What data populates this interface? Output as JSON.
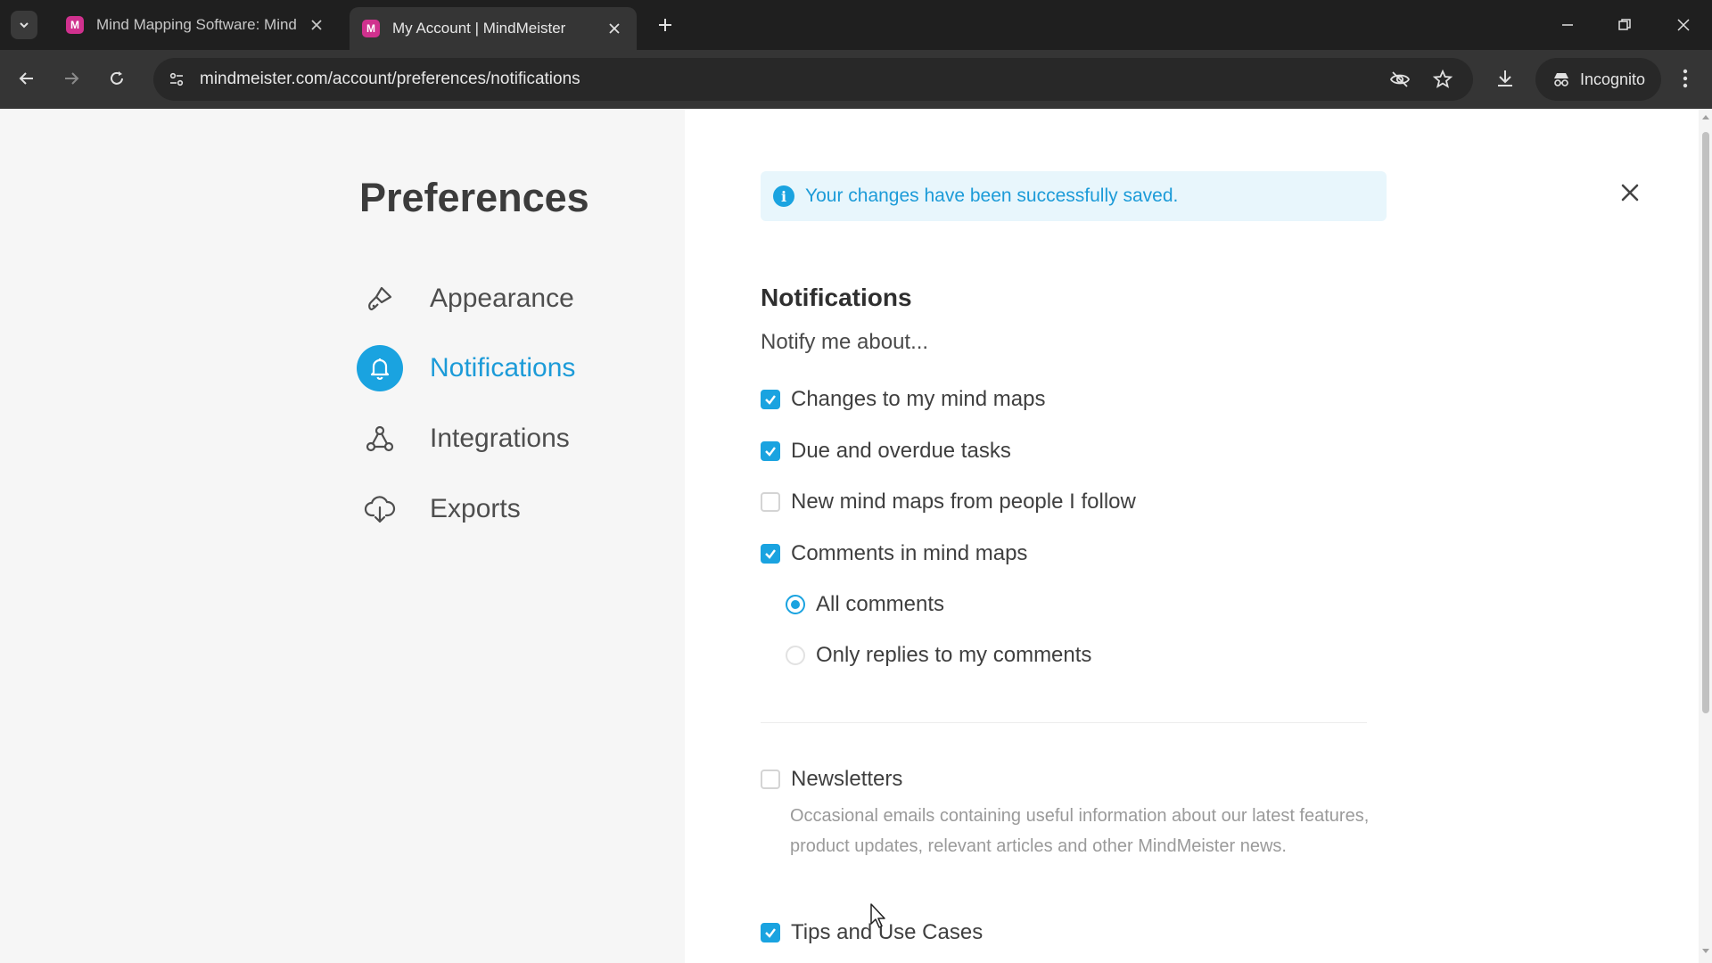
{
  "browser": {
    "tabs": [
      {
        "favicon": "M",
        "title": "Mind Mapping Software: Mind",
        "active": false
      },
      {
        "favicon": "M",
        "title": "My Account | MindMeister",
        "active": true
      }
    ],
    "url": "mindmeister.com/account/preferences/notifications",
    "incognito_label": "Incognito"
  },
  "sidebar": {
    "title": "Preferences",
    "items": [
      {
        "label": "Appearance",
        "icon": "paint-brush-icon",
        "active": false
      },
      {
        "label": "Notifications",
        "icon": "bell-icon",
        "active": true
      },
      {
        "label": "Integrations",
        "icon": "nodes-icon",
        "active": false
      },
      {
        "label": "Exports",
        "icon": "cloud-download-icon",
        "active": false
      }
    ]
  },
  "banner": {
    "message": "Your changes have been successfully saved."
  },
  "notifications": {
    "title": "Notifications",
    "intro": "Notify me about...",
    "options": [
      {
        "label": "Changes to my mind maps",
        "checked": true
      },
      {
        "label": "Due and overdue tasks",
        "checked": true
      },
      {
        "label": "New mind maps from people I follow",
        "checked": false
      },
      {
        "label": "Comments in mind maps",
        "checked": true
      }
    ],
    "comment_options": [
      {
        "label": "All comments",
        "selected": true
      },
      {
        "label": "Only replies to my comments",
        "selected": false
      }
    ],
    "newsletters": {
      "label": "Newsletters",
      "checked": false,
      "description": "Occasional emails containing useful information about our latest features, product updates, relevant articles and other MindMeister news."
    },
    "tips": {
      "label": "Tips and Use Cases",
      "checked": true
    }
  },
  "colors": {
    "accent": "#1aa3e0",
    "chrome_dark": "#1f1f1f",
    "chrome_toolbar": "#353535",
    "sidebar_bg": "#f6f6f6"
  }
}
